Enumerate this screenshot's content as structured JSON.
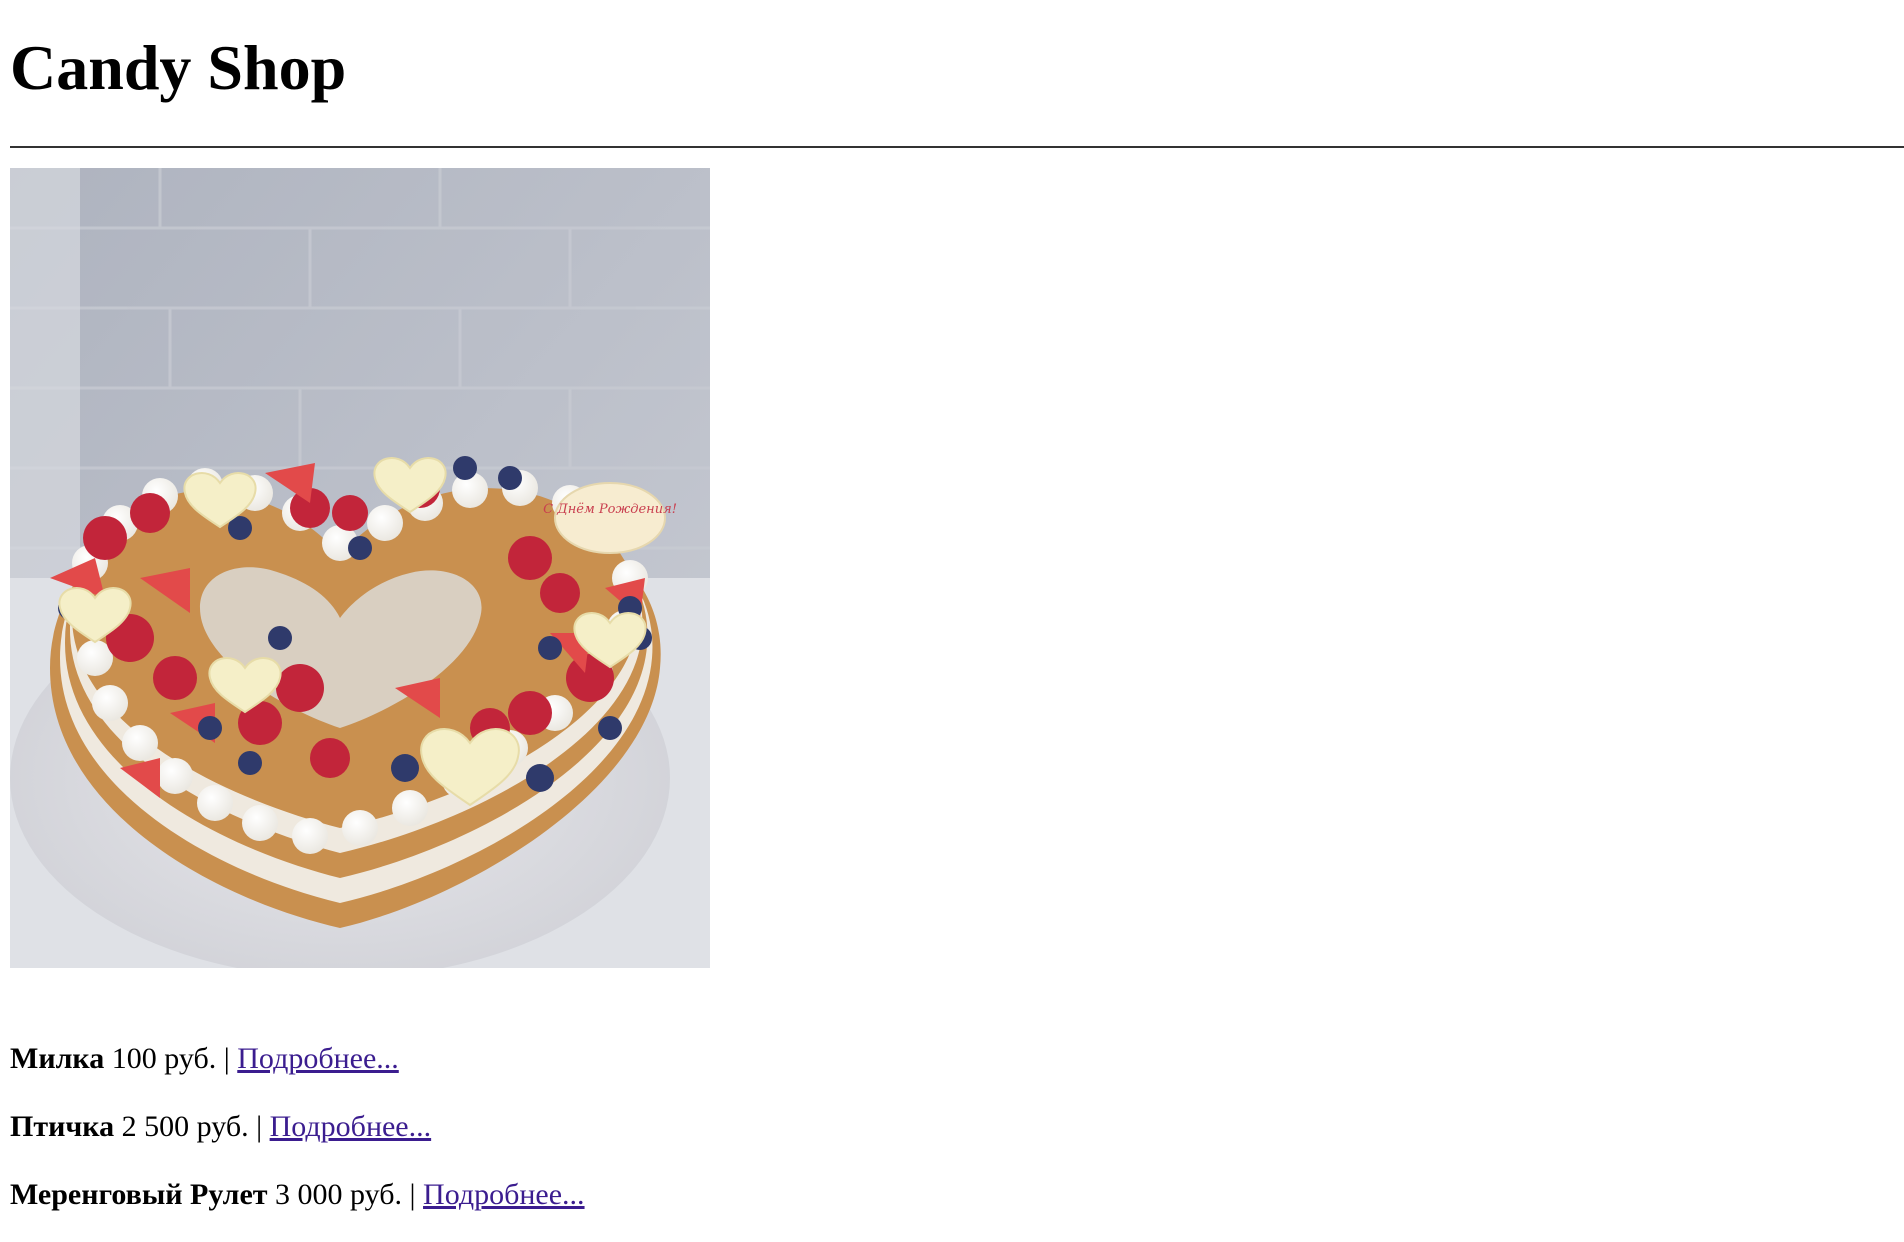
{
  "header": {
    "title": "Candy Shop"
  },
  "hero_image": {
    "icon": "heart-cake-image",
    "topper_text": "С Днём Рождения!"
  },
  "products": [
    {
      "name": "Милка",
      "price": "100 руб.",
      "separator": "|",
      "link_label": "Подробнее..."
    },
    {
      "name": "Птичка",
      "price": "2 500 руб.",
      "separator": "|",
      "link_label": "Подробнее..."
    },
    {
      "name": "Меренговый Рулет",
      "price": "3 000 руб.",
      "separator": "|",
      "link_label": "Подробнее..."
    }
  ],
  "colors": {
    "link": "#3b1d8f",
    "text": "#000000",
    "background": "#ffffff"
  }
}
